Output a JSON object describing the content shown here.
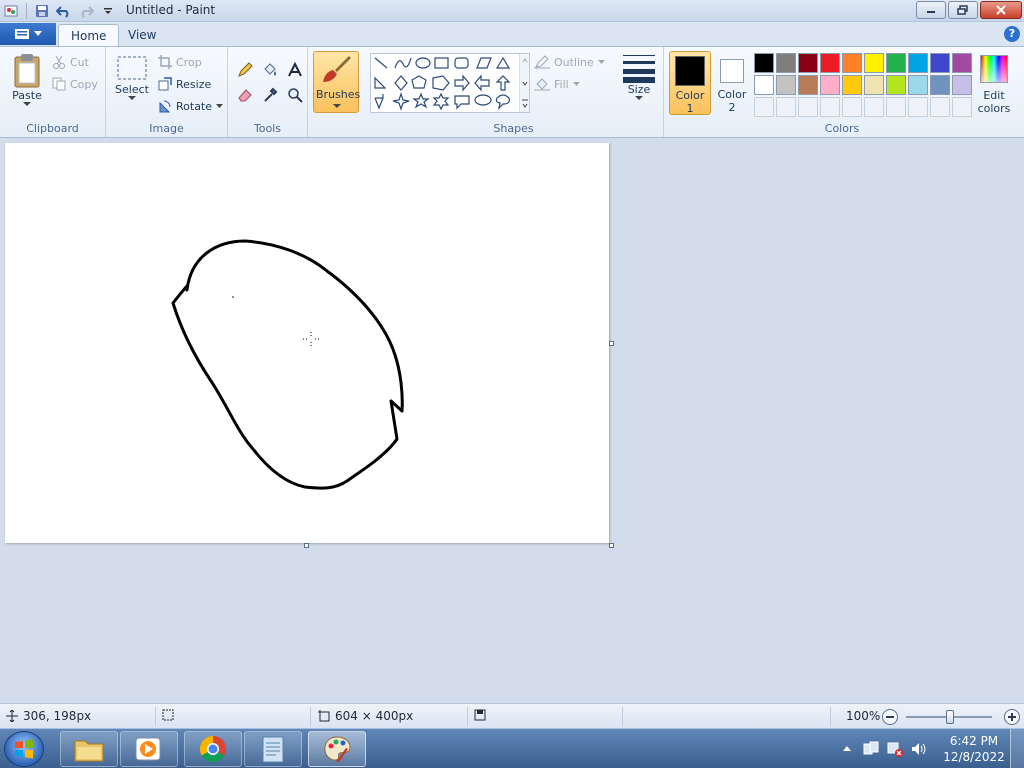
{
  "window": {
    "title": "Untitled - Paint"
  },
  "tabs": {
    "home": "Home",
    "view": "View"
  },
  "clipboard": {
    "paste": "Paste",
    "cut": "Cut",
    "copy": "Copy",
    "label": "Clipboard"
  },
  "image": {
    "select": "Select",
    "crop": "Crop",
    "resize": "Resize",
    "rotate": "Rotate",
    "label": "Image"
  },
  "tools": {
    "label": "Tools"
  },
  "brushes": {
    "label": "Brushes"
  },
  "shapes": {
    "outline": "Outline",
    "fill": "Fill",
    "label": "Shapes"
  },
  "size": {
    "label": "Size"
  },
  "colors": {
    "color1": "Color",
    "color1_num": "1",
    "color2": "Color",
    "color2_num": "2",
    "edit": "Edit",
    "edit2": "colors",
    "label": "Colors",
    "palette_row1": [
      "#000000",
      "#7f7f7f",
      "#880015",
      "#ed1c24",
      "#ff7f27",
      "#fff200",
      "#22b14c",
      "#00a2e8",
      "#3f48cc",
      "#a349a4"
    ],
    "palette_row2": [
      "#ffffff",
      "#c3c3c3",
      "#b97a57",
      "#ffaec9",
      "#ffc90e",
      "#efe4b0",
      "#b5e61d",
      "#99d9ea",
      "#7092be",
      "#c8bfe7"
    ]
  },
  "status": {
    "cursor_pos": "306, 198px",
    "canvas_size": "604 × 400px",
    "zoom": "100%"
  },
  "taskbar": {
    "time": "6:42 PM",
    "date": "12/8/2022"
  }
}
